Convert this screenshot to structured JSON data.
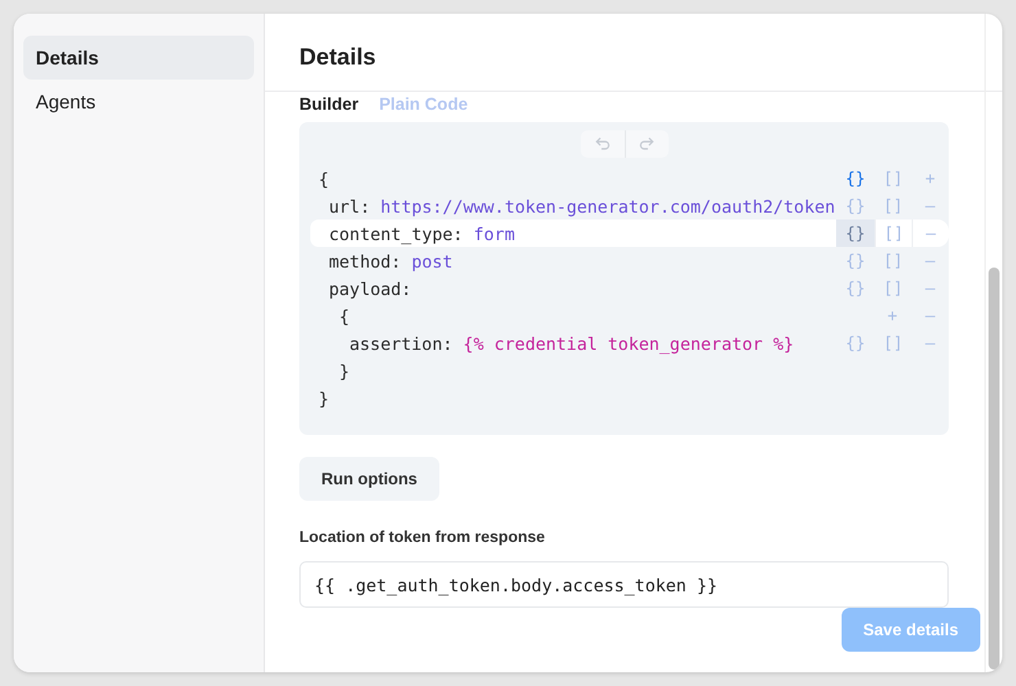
{
  "sidebar": {
    "items": [
      {
        "label": "Details",
        "selected": true
      },
      {
        "label": "Agents",
        "selected": false
      }
    ]
  },
  "header": {
    "title": "Details"
  },
  "editor_tabs": [
    {
      "label": "Builder",
      "selected": true
    },
    {
      "label": "Plain Code",
      "selected": false
    }
  ],
  "builder": {
    "toolbar": [
      {
        "kind": "undo"
      },
      {
        "kind": "redo"
      }
    ],
    "root": {
      "text": "{",
      "close": "}",
      "selected": false,
      "actions": [
        {
          "label": "{}",
          "active": true
        },
        {
          "label": "[]",
          "active": false
        },
        {
          "label": "+",
          "active": false
        }
      ],
      "children": [
        {
          "key": "url:",
          "value": "https://www.token-generator.com/oauth2/token",
          "kind": "string",
          "selected": false,
          "actions": [
            {
              "label": "{}",
              "active": false
            },
            {
              "label": "[]",
              "active": false
            },
            {
              "label": "—",
              "active": false
            }
          ]
        },
        {
          "key": "content_type:",
          "value": "form",
          "kind": "string",
          "selected": true,
          "actions": [
            {
              "label": "{}",
              "active": false
            },
            {
              "label": "[]",
              "active": false
            },
            {
              "label": "—",
              "active": false
            }
          ]
        },
        {
          "key": "method:",
          "value": "post",
          "kind": "string",
          "selected": false,
          "actions": [
            {
              "label": "{}",
              "active": false
            },
            {
              "label": "[]",
              "active": false
            },
            {
              "label": "—",
              "active": false
            }
          ]
        },
        {
          "key": "payload:",
          "selected": false,
          "actions": [
            {
              "label": "{}",
              "active": false
            },
            {
              "label": "[]",
              "active": false
            },
            {
              "label": "—",
              "active": false
            }
          ],
          "children": [
            {
              "text": "{",
              "close": "}",
              "selected": false,
              "actions": [
                {
                  "label": "+",
                  "active": false
                },
                {
                  "label": "—",
                  "active": false
                }
              ],
              "children": [
                {
                  "key": "assertion:",
                  "value": "{% credential token_generator %}",
                  "kind": "template",
                  "selected": false,
                  "actions": [
                    {
                      "label": "{}",
                      "active": false
                    },
                    {
                      "label": "[]",
                      "active": false
                    },
                    {
                      "label": "—",
                      "active": false
                    }
                  ]
                }
              ]
            }
          ]
        }
      ]
    }
  },
  "run_options_button": "Run options",
  "token_location": {
    "label": "Location of token from response",
    "value": "{{ .get_auth_token.body.access_token }}"
  },
  "save_button": {
    "label": "Save details",
    "disabled": true
  }
}
